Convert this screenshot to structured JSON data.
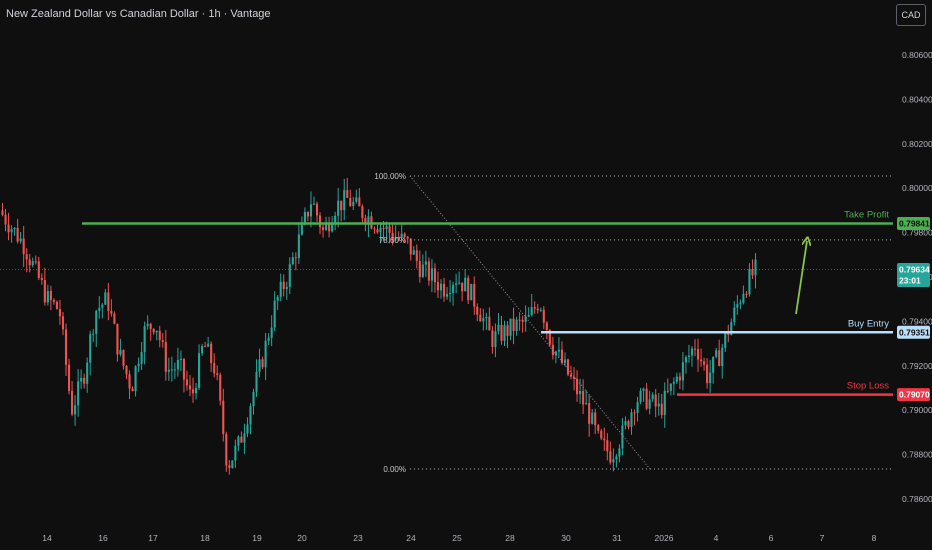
{
  "header": {
    "title": "New Zealand Dollar vs Canadian Dollar · 1h · Vantage",
    "currency_button": "CAD"
  },
  "colors": {
    "up": "#26a69a",
    "down": "#ef5350",
    "take_profit": "#4caf50",
    "buy_entry": "#bbdefb",
    "stop_loss": "#f23645",
    "arrow": "#8bc34a"
  },
  "chart_data": {
    "type": "candlestick",
    "symbol": "NZDCAD",
    "timeframe": "1h",
    "xlabel": "",
    "ylabel": "",
    "ylim": [
      0.7852,
      0.808
    ],
    "grid": false,
    "y_ticks": [
      "0.80600",
      "0.80400",
      "0.80200",
      "0.80000",
      "0.79800",
      "0.79600",
      "0.79400",
      "0.79200",
      "0.79000",
      "0.78800",
      "0.78600"
    ],
    "x_ticks": [
      "14",
      "16",
      "17",
      "18",
      "19",
      "20",
      "23",
      "24",
      "25",
      "28",
      "30",
      "31",
      "2026",
      "4",
      "6",
      "7",
      "8"
    ],
    "price_path": [
      [
        0,
        0.799
      ],
      [
        2,
        0.7975
      ],
      [
        4,
        0.795
      ],
      [
        5,
        0.7945
      ],
      [
        6,
        0.79
      ],
      [
        7,
        0.7915
      ],
      [
        8,
        0.7945
      ],
      [
        9,
        0.795
      ],
      [
        10,
        0.7925
      ],
      [
        11,
        0.791
      ],
      [
        12,
        0.7935
      ],
      [
        13,
        0.794
      ],
      [
        14,
        0.7918
      ],
      [
        15,
        0.792
      ],
      [
        16,
        0.7905
      ],
      [
        17,
        0.793
      ],
      [
        18,
        0.7918
      ],
      [
        19,
        0.7875
      ],
      [
        20,
        0.7885
      ],
      [
        21,
        0.7905
      ],
      [
        22,
        0.7925
      ],
      [
        23,
        0.7948
      ],
      [
        24,
        0.796
      ],
      [
        26,
        0.7995
      ],
      [
        27,
        0.798
      ],
      [
        28,
        0.7992
      ],
      [
        29,
        0.7995
      ],
      [
        30,
        0.799
      ],
      [
        32,
        0.7982
      ],
      [
        34,
        0.7975
      ],
      [
        35,
        0.7965
      ],
      [
        37,
        0.7955
      ],
      [
        38,
        0.796
      ],
      [
        39,
        0.7955
      ],
      [
        40,
        0.7945
      ],
      [
        41,
        0.7932
      ],
      [
        43,
        0.7938
      ],
      [
        44,
        0.794
      ],
      [
        45,
        0.795
      ],
      [
        46,
        0.793
      ],
      [
        47,
        0.792
      ],
      [
        48,
        0.791
      ],
      [
        49,
        0.79
      ],
      [
        50,
        0.7885
      ],
      [
        51,
        0.788
      ],
      [
        52,
        0.789
      ],
      [
        53,
        0.7905
      ],
      [
        54,
        0.7905
      ],
      [
        55,
        0.79
      ],
      [
        56,
        0.791
      ],
      [
        57,
        0.792
      ],
      [
        58,
        0.793
      ],
      [
        59,
        0.7915
      ],
      [
        60,
        0.7925
      ],
      [
        61,
        0.794
      ],
      [
        62,
        0.7955
      ],
      [
        63,
        0.7963
      ]
    ],
    "fib_levels": [
      {
        "label": "100.00%",
        "price": 0.80055
      },
      {
        "label": "78.60%",
        "price": 0.79767
      },
      {
        "label": "0.00%",
        "price": 0.78735
      }
    ],
    "levels": [
      {
        "name": "Take Profit",
        "price": 0.79841,
        "price_label": "0.79841"
      },
      {
        "name": "Buy Entry",
        "price": 0.79351,
        "price_label": "0.79351"
      },
      {
        "name": "Stop Loss",
        "price": 0.7907,
        "price_label": "0.79070"
      }
    ],
    "current_price": {
      "price_label": "0.79634",
      "countdown": "23:01",
      "price": 0.79634
    },
    "annotations": [
      "projected-up-arrow"
    ]
  }
}
